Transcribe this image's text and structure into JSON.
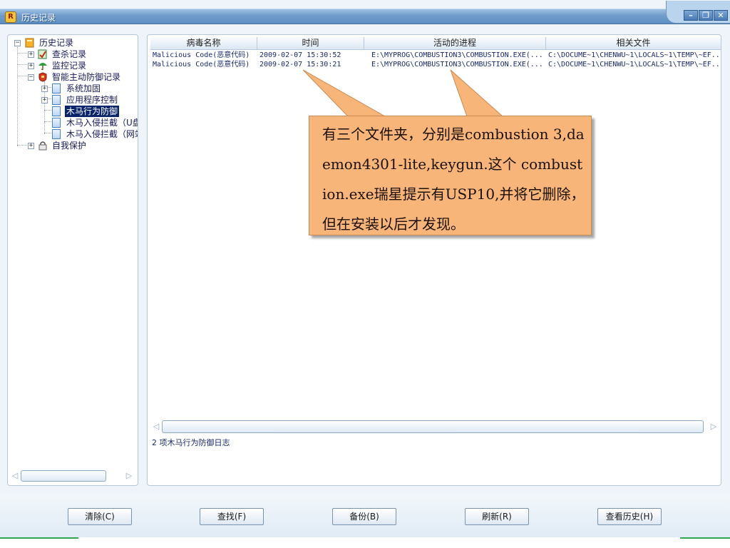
{
  "window": {
    "title": "历史记录",
    "controls": {
      "minimize": "–",
      "restore": "❐",
      "close": "✕"
    }
  },
  "tree": {
    "root": "历史记录",
    "items": [
      {
        "label": "查杀记录"
      },
      {
        "label": "监控记录"
      },
      {
        "label": "智能主动防御记录"
      },
      {
        "label": "系统加固"
      },
      {
        "label": "应用程序控制"
      },
      {
        "label": "木马行为防御"
      },
      {
        "label": "木马入侵拦截（U盘"
      },
      {
        "label": "木马入侵拦截（网站"
      },
      {
        "label": "自我保护"
      }
    ],
    "expand_plus": "+",
    "expand_minus": "−"
  },
  "list": {
    "columns": [
      "病毒名称",
      "时间",
      "活动的进程",
      "相关文件"
    ],
    "rows": [
      [
        "Malicious Code(恶意代码)",
        "2009-02-07 15:30:52",
        "E:\\MYPROG\\COMBUSTION3\\COMBUSTION.EXE(...",
        "C:\\DOCUME~1\\CHENWU~1\\LOCALS~1\\TEMP\\~EF..."
      ],
      [
        "Malicious Code(恶意代码)",
        "2009-02-07 15:30:21",
        "E:\\MYPROG\\COMBUSTION3\\COMBUSTION.EXE(...",
        "C:\\DOCUME~1\\CHENWU~1\\LOCALS~1\\TEMP\\~EF..."
      ]
    ],
    "status": "2 项木马行为防御日志"
  },
  "callout": {
    "text": "有三个文件夹，分别是combustion 3,daemon4301-lite,keygun.这个 combustion.exe瑞星提示有USP10,并将它删除，但在安装以后才发现。"
  },
  "buttons": {
    "clear": "清除(C)",
    "find": "查找(F)",
    "backup": "备份(B)",
    "refresh": "刷新(R)",
    "view_history": "查看历史(H)"
  },
  "scroll": {
    "left_arrow": "◁",
    "right_arrow": "▷"
  },
  "colors": {
    "titlebar": "#6f9ccb",
    "selection": "#0a246a",
    "callout": "#f7b57a"
  }
}
